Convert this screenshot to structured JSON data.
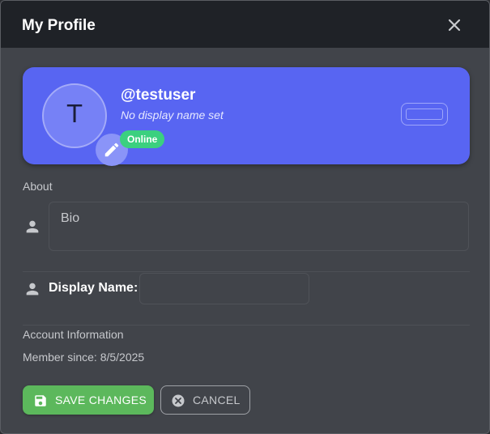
{
  "dialog": {
    "title": "My Profile",
    "close_icon": "close-icon"
  },
  "profile": {
    "avatar_letter": "T",
    "username": "@testuser",
    "display_name_note": "No display name set",
    "status": "Online",
    "edit_icon": "pencil-icon",
    "colors": {
      "card": "#5865f2",
      "status": "#3bd07f"
    }
  },
  "about": {
    "label": "About",
    "bio_placeholder": "Bio",
    "icon": "person-icon"
  },
  "display_name": {
    "label": "Display Name:",
    "value": "",
    "icon": "person-icon"
  },
  "account": {
    "label": "Account Information",
    "member_since": "Member since: 8/5/2025"
  },
  "actions": {
    "save_label": "SAVE CHANGES",
    "save_icon": "save-icon",
    "save_color": "#5cb85c",
    "cancel_label": "CANCEL",
    "cancel_icon": "cancel-circle-icon"
  }
}
